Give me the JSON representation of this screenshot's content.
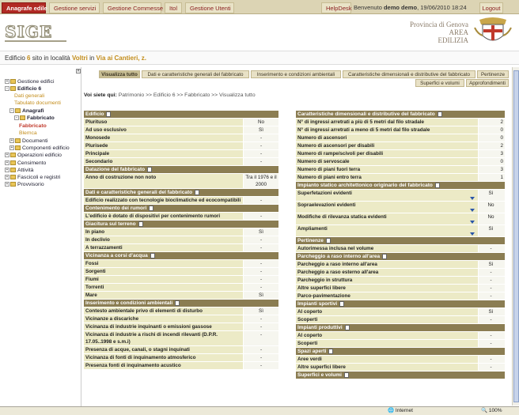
{
  "topnav": {
    "tabs": [
      {
        "label": "Anagrafe edile",
        "active": true
      },
      {
        "label": "Gestione servizi"
      },
      {
        "label": "Gestione Commesse"
      },
      {
        "label": "Itol"
      },
      {
        "label": "Gestione Utenti"
      }
    ],
    "helpdesk": "HelpDesk",
    "welcome_prefix": "Benvenuto",
    "user": "demo demo",
    "datetime": ", 19/06/2010 18:24",
    "logout": "Logout"
  },
  "header": {
    "logo": "SIGE",
    "province_line1": "Provincia di Genova",
    "province_line2": "AREA",
    "province_line3": "EDILIZIA"
  },
  "location": {
    "prefix": "Edificio",
    "number": "6",
    "middle": "sito in località",
    "locality": "Voltri",
    "in": "in",
    "street": "Via ai Cantieri,",
    "civic": "z."
  },
  "sidebar": {
    "items": [
      {
        "label": "Gestione edifici",
        "pm": "+"
      },
      {
        "label": "Edificio 6",
        "pm": "-"
      },
      {
        "label": "Dati generali"
      },
      {
        "label": "Tabulato documenti"
      },
      {
        "label": "Anagrafi",
        "pm": "-"
      },
      {
        "label": "Fabbricato",
        "pm": "-"
      },
      {
        "label": "Fabbricato"
      },
      {
        "label": "Blemca"
      },
      {
        "label": "Documenti",
        "pm": "+"
      },
      {
        "label": "Componenti edificio",
        "pm": "+"
      },
      {
        "label": "Operazioni edificio",
        "pm": "+"
      },
      {
        "label": "Censimento",
        "pm": "+"
      },
      {
        "label": "Attività",
        "pm": "+"
      },
      {
        "label": "Fascicoli e registri",
        "pm": "+"
      },
      {
        "label": "Provvisorio",
        "pm": "+"
      }
    ]
  },
  "tabs": [
    {
      "label": "Visualizza tutto"
    },
    {
      "label": "Dati e caratteristiche generali del fabbricato"
    },
    {
      "label": "Inserimento e condizioni ambientali"
    },
    {
      "label": "Caratteristiche dimensionali e distributive del fabbricato"
    },
    {
      "label": "Pertinenze"
    },
    {
      "label": "Superfici e volumi"
    },
    {
      "label": "Approfondimenti"
    }
  ],
  "breadcrumb": {
    "prefix": "Voi siete qui:",
    "path": "Patrimonio >> Edificio 6 >> Fabbricato >> Visualizza tutto"
  },
  "left_sections": [
    {
      "title": "Edificio",
      "rows": [
        [
          "Plurituso",
          "No"
        ],
        [
          "Ad uso esclusivo",
          "Sì"
        ],
        [
          "Monosede",
          "-"
        ],
        [
          "Plurisede",
          "-"
        ],
        [
          "Principale",
          "-"
        ],
        [
          "Secondario",
          "-"
        ]
      ]
    },
    {
      "title": "Datazione del fabbricato",
      "rows": [
        [
          "Anno di costruzione non noto",
          "Tra il 1976 e il 2000"
        ]
      ]
    },
    {
      "title": "Dati e caratteristiche generali del fabbricato",
      "rows": [
        [
          "Edificio realizzato con tecnologie bioclimatiche ed ecocompatibili",
          "-"
        ]
      ]
    },
    {
      "title": "Contenimento dei rumori",
      "rows": [
        [
          "L'edificio è dotato di dispositivi per contenimento rumori",
          "-"
        ]
      ]
    },
    {
      "title": "Giacitura sul terreno",
      "rows": [
        [
          "In piano",
          "Sì"
        ],
        [
          "In declivio",
          "-"
        ],
        [
          "A terrazzamenti",
          "-"
        ]
      ]
    },
    {
      "title": "Vicinanza a corsi d'acqua",
      "rows": [
        [
          "Fossi",
          "-"
        ],
        [
          "Sorgenti",
          "-"
        ],
        [
          "Fiumi",
          "-"
        ],
        [
          "Torrenti",
          "-"
        ],
        [
          "Mare",
          "Sì"
        ]
      ]
    },
    {
      "title": "Inserimento e condizioni ambientali",
      "rows": [
        [
          "Contesto ambientale privo di elementi di disturbo",
          "Sì"
        ],
        [
          "Vicinanze a discariche",
          "-"
        ],
        [
          "Vicinanza di industrie inquinanti o emissioni gassose",
          "-"
        ],
        [
          "Vicinanza di industrie a rischi di incendi rilevanti (D.P.R. 17.05..1998 e s.m.i)",
          "-"
        ],
        [
          "Presenza di acque, canali, o stagni inquinati",
          "-"
        ],
        [
          "Vicinanza di fonti di inquinamento atmosferico",
          "-"
        ],
        [
          "Presenza fonti di inquinamento acustico",
          "-"
        ]
      ]
    }
  ],
  "right_sections": [
    {
      "title": "Caratteristiche dimensionali e distributive del fabbricato",
      "rows": [
        [
          "N° di ingressi arretrati a più di 5 metri dal filo stradale",
          "2"
        ],
        [
          "N° di ingressi arretrati a meno di 5 metri dal filo stradale",
          "0"
        ],
        [
          "Numero di ascensori",
          "0"
        ],
        [
          "Numero di ascensori per disabili",
          "2"
        ],
        [
          "Numero di rampe/scivoli per disabili",
          "3"
        ],
        [
          "Numero di servoscale",
          "0"
        ],
        [
          "Numero di piani fuori terra",
          "3"
        ],
        [
          "Numero di piani entro terra",
          "1"
        ]
      ]
    },
    {
      "title": "Impianto statico architettonico originario del fabbricato",
      "rows": [
        [
          "Superfetazioni evidenti",
          "Sì",
          true
        ],
        [
          "Sopraelevazioni evidenti",
          "No",
          true
        ],
        [
          "Modifiche di rilevanza statica evidenti",
          "No",
          true
        ],
        [
          "Ampliamenti",
          "Sì",
          true
        ]
      ]
    },
    {
      "title": "Pertinenze",
      "rows": [
        [
          "Autorimessa inclusa nel volume",
          "-"
        ]
      ]
    },
    {
      "title": "Parcheggio a raso interno all'area",
      "rows": [
        [
          "Parcheggio a raso interno all'area",
          "Sì"
        ],
        [
          "Parcheggio a raso esterno all'area",
          "-"
        ],
        [
          "Parcheggio in struttura",
          "-"
        ],
        [
          "Altre superfici libere",
          "-"
        ],
        [
          "Parco-pavimentazione",
          "-"
        ]
      ]
    },
    {
      "title": "Impianti sportivi",
      "rows": [
        [
          "Al coperto",
          "Sì"
        ],
        [
          "Scoperti",
          "-"
        ]
      ]
    },
    {
      "title": "Impianti produttivi",
      "rows": [
        [
          "Al coperto",
          "-"
        ],
        [
          "Scoperti",
          "-"
        ]
      ]
    },
    {
      "title": "Spazi aperti",
      "rows": [
        [
          "Aree verdi",
          "-"
        ],
        [
          "Altre superfici libere",
          "-"
        ]
      ]
    },
    {
      "title": "Superfici e volumi",
      "rows": []
    }
  ],
  "status": {
    "internet": "Internet",
    "zoom": "100%"
  },
  "colors": {
    "accent": "#b12a24",
    "section": "#8b7d52",
    "row_label": "#eceac6",
    "link": "#c38d1b"
  }
}
